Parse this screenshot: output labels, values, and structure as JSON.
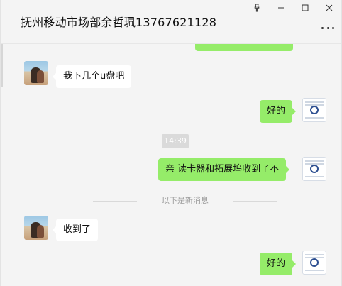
{
  "window": {
    "title": "抚州移动市场部余哲珮13767621128",
    "pin_icon": "pin-icon",
    "minimize_icon": "minimize-icon",
    "maximize_icon": "maximize-icon",
    "close_icon": "close-icon",
    "more_icon": "more-icon"
  },
  "messages": [
    {
      "id": "m1",
      "side": "left",
      "text": "我下几个u盘吧"
    },
    {
      "id": "m2",
      "side": "right",
      "text": "好的"
    },
    {
      "id": "t1",
      "type": "time",
      "text": "14:39"
    },
    {
      "id": "m3",
      "side": "right",
      "text": "亲 读卡器和拓展坞收到了不"
    },
    {
      "id": "d1",
      "type": "divider",
      "text": "以下是新消息"
    },
    {
      "id": "m4",
      "side": "left",
      "text": "收到了"
    },
    {
      "id": "m5",
      "side": "right",
      "text": "好的"
    }
  ],
  "colors": {
    "background": "#f4f4f4",
    "bubble_right": "#95ec69",
    "bubble_left": "#ffffff",
    "time_badge": "#dadada"
  }
}
